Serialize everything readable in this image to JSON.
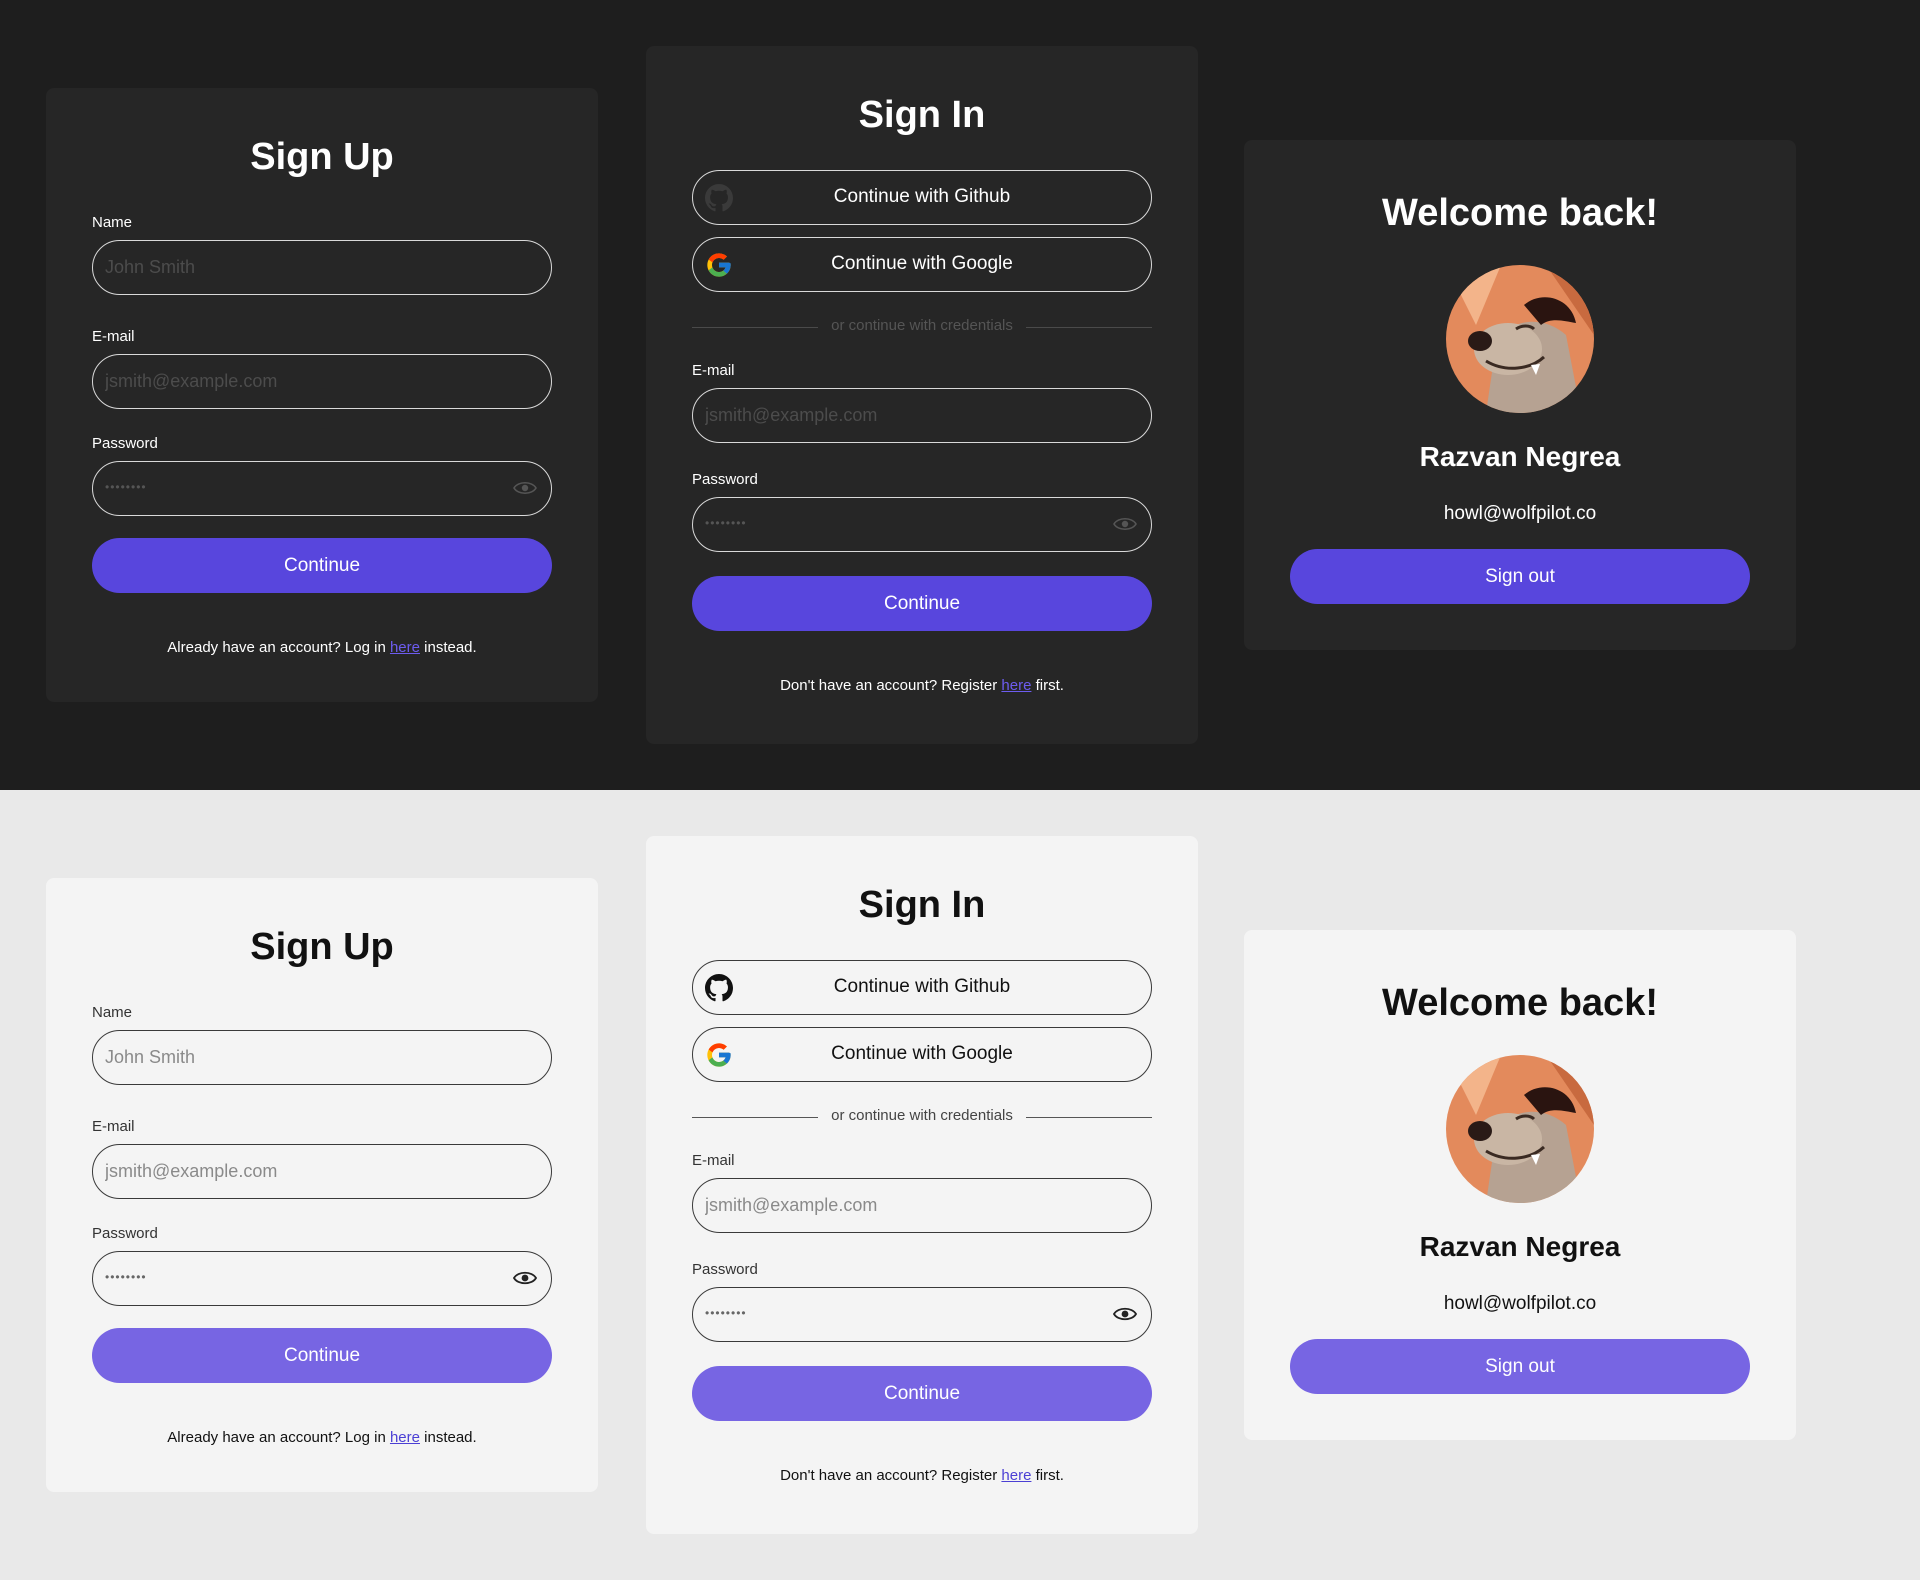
{
  "signup": {
    "title": "Sign Up",
    "name_label": "Name",
    "name_placeholder": "John Smith",
    "email_label": "E-mail",
    "email_placeholder": "jsmith@example.com",
    "password_label": "Password",
    "password_value": "••••••••",
    "continue_label": "Continue",
    "footer_prefix": "Already have an account? Log in ",
    "footer_link": "here",
    "footer_suffix": " instead."
  },
  "signin": {
    "title": "Sign In",
    "github_label": "Continue with Github",
    "google_label": "Continue with Google",
    "divider_text": "or continue with credentials",
    "email_label": "E-mail",
    "email_placeholder": "jsmith@example.com",
    "password_label": "Password",
    "password_value": "••••••••",
    "continue_label": "Continue",
    "footer_prefix": "Don't have an account? Register ",
    "footer_link": "here",
    "footer_suffix": " first."
  },
  "profile": {
    "title": "Welcome back!",
    "name": "Razvan Negrea",
    "email": "howl@wolfpilot.co",
    "signout_label": "Sign out",
    "avatar_icon": "wolf-avatar"
  },
  "colors": {
    "dark_bg": "#1e1e1e",
    "dark_card": "#262626",
    "light_bg": "#e9e9e9",
    "light_card": "#f4f4f4",
    "accent_dark": "#5846dd",
    "accent_light": "#7765e3"
  }
}
